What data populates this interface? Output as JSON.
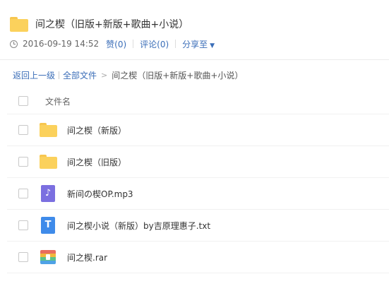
{
  "share": {
    "title": "间之楔（旧版+新版+歌曲+小说）",
    "datetime": "2016-09-19 14:52",
    "like_label": "赞(0)",
    "comment_label": "评论(0)",
    "share_label": "分享至",
    "icons": {
      "title": "folder-icon",
      "time": "clock-icon",
      "share_menu": "chevron-down-icon"
    }
  },
  "breadcrumb": {
    "back_label": "返回上一级",
    "all_files_label": "全部文件",
    "current": "间之楔（旧版+新版+歌曲+小说）"
  },
  "file_list": {
    "column_header": "文件名",
    "items": [
      {
        "name": "间之楔（新版）",
        "type": "folder"
      },
      {
        "name": "间之楔（旧版）",
        "type": "folder"
      },
      {
        "name": "新间の楔OP.mp3",
        "type": "audio"
      },
      {
        "name": "间之楔小说（新版）by吉原理惠子.txt",
        "type": "text"
      },
      {
        "name": "间之楔.rar",
        "type": "archive"
      }
    ]
  },
  "icon_glyphs": {
    "audio": "♪",
    "text": "T"
  },
  "colors": {
    "link": "#3b6eb8",
    "folder": "#fbd15c",
    "audio": "#7b6fe0",
    "text": "#3f8bea"
  }
}
